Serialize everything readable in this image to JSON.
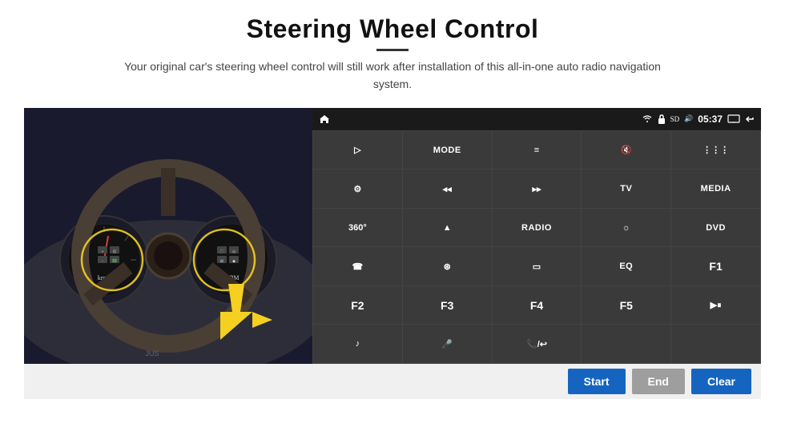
{
  "header": {
    "title": "Steering Wheel Control",
    "subtitle": "Your original car's steering wheel control will still work after installation of this all-in-one auto radio navigation system."
  },
  "statusBar": {
    "time": "05:37",
    "homeIcon": "⌂",
    "wifiIcon": "wifi",
    "lockIcon": "🔒",
    "sdIcon": "SD",
    "btIcon": "BT",
    "soundIcon": "🔊",
    "backIcon": "↩",
    "appsIcon": "⋮⋮"
  },
  "buttons": [
    {
      "id": "send",
      "label": "▷",
      "type": "icon",
      "row": 1,
      "col": 1
    },
    {
      "id": "mode",
      "label": "MODE",
      "type": "text",
      "row": 1,
      "col": 2
    },
    {
      "id": "list",
      "label": "≡",
      "type": "icon",
      "row": 1,
      "col": 3
    },
    {
      "id": "mute",
      "label": "🔇",
      "type": "icon",
      "row": 1,
      "col": 4
    },
    {
      "id": "apps",
      "label": "⋮⋮⋮",
      "type": "icon",
      "row": 1,
      "col": 5
    },
    {
      "id": "settings",
      "label": "⚙",
      "type": "icon",
      "row": 2,
      "col": 1
    },
    {
      "id": "prev",
      "label": "◂◂",
      "type": "icon",
      "row": 2,
      "col": 2
    },
    {
      "id": "next",
      "label": "▸▸",
      "type": "icon",
      "row": 2,
      "col": 3
    },
    {
      "id": "tv",
      "label": "TV",
      "type": "text",
      "row": 2,
      "col": 4
    },
    {
      "id": "media",
      "label": "MEDIA",
      "type": "text",
      "row": 2,
      "col": 5
    },
    {
      "id": "cam360",
      "label": "360°",
      "type": "icon",
      "row": 3,
      "col": 1
    },
    {
      "id": "eject",
      "label": "▲",
      "type": "icon",
      "row": 3,
      "col": 2
    },
    {
      "id": "radio",
      "label": "RADIO",
      "type": "text",
      "row": 3,
      "col": 3
    },
    {
      "id": "brightness",
      "label": "☼",
      "type": "icon",
      "row": 3,
      "col": 4
    },
    {
      "id": "dvd",
      "label": "DVD",
      "type": "text",
      "row": 3,
      "col": 5
    },
    {
      "id": "phone",
      "label": "☎",
      "type": "icon",
      "row": 4,
      "col": 1
    },
    {
      "id": "compass",
      "label": "⊛",
      "type": "icon",
      "row": 4,
      "col": 2
    },
    {
      "id": "display",
      "label": "▭",
      "type": "icon",
      "row": 4,
      "col": 3
    },
    {
      "id": "eq",
      "label": "EQ",
      "type": "text",
      "row": 4,
      "col": 4
    },
    {
      "id": "f1",
      "label": "F1",
      "type": "text",
      "row": 4,
      "col": 5
    },
    {
      "id": "f2",
      "label": "F2",
      "type": "text",
      "row": 5,
      "col": 1
    },
    {
      "id": "f3",
      "label": "F3",
      "type": "text",
      "row": 5,
      "col": 2
    },
    {
      "id": "f4",
      "label": "F4",
      "type": "text",
      "row": 5,
      "col": 3
    },
    {
      "id": "f5",
      "label": "F5",
      "type": "text",
      "row": 5,
      "col": 4
    },
    {
      "id": "playpause",
      "label": "▶⏸",
      "type": "icon",
      "row": 5,
      "col": 5
    },
    {
      "id": "music",
      "label": "♪",
      "type": "icon",
      "row": 6,
      "col": 1
    },
    {
      "id": "mic",
      "label": "🎤",
      "type": "icon",
      "row": 6,
      "col": 2
    },
    {
      "id": "handfree",
      "label": "📞/↩",
      "type": "icon",
      "row": 6,
      "col": 3
    }
  ],
  "bottomBar": {
    "startLabel": "Start",
    "endLabel": "End",
    "clearLabel": "Clear"
  }
}
